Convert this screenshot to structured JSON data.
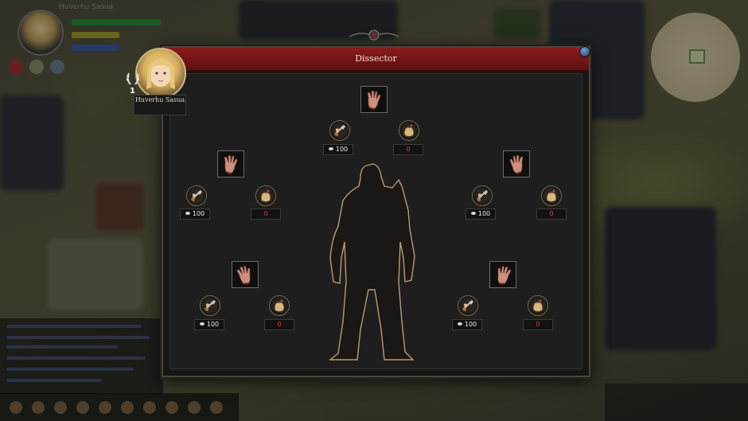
{
  "party": {
    "name": "Huverhu Sasua"
  },
  "dialog": {
    "title": "Dissector"
  },
  "character": {
    "name": "Huverhu Sasua",
    "level": "1"
  },
  "parts": [
    {
      "id": "top",
      "tool_cost": "100",
      "yield": "0"
    },
    {
      "id": "upper-left",
      "tool_cost": "100",
      "yield": "0"
    },
    {
      "id": "upper-right",
      "tool_cost": "100",
      "yield": "0"
    },
    {
      "id": "lower-left",
      "tool_cost": "100",
      "yield": "0"
    },
    {
      "id": "lower-right",
      "tool_cost": "100",
      "yield": "0"
    }
  ],
  "icons": {
    "part": "hand-icon",
    "tool": "dissect-tool-icon",
    "yield": "sack-icon",
    "close": "close-icon"
  },
  "colors": {
    "header": "#8a1c1c",
    "yield_text": "#d04a30",
    "cost_text": "#e8e8e8"
  }
}
